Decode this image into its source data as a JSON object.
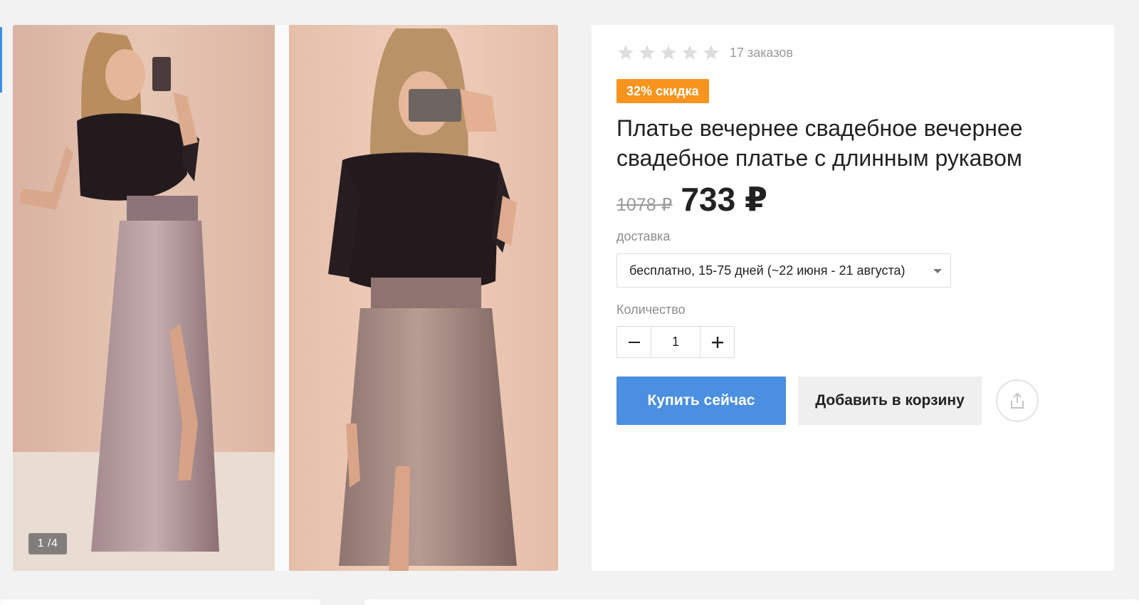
{
  "gallery": {
    "counter": "1 /4",
    "current_image": 1,
    "total_images": 4
  },
  "product": {
    "rating": {
      "stars_filled": 0,
      "stars_total": 5
    },
    "orders": "17 заказов",
    "discount_badge": "32% скидка",
    "title": "Платье вечернее свадебное вечернее свадебное платье с длинным рукавом",
    "old_price": "1078 ₽",
    "new_price": "733 ₽"
  },
  "delivery": {
    "label": "доставка",
    "selected": "бесплатно, 15-75 дней (~22 июня - 21 августа)"
  },
  "quantity": {
    "label": "Количество",
    "value": "1"
  },
  "actions": {
    "buy_label": "Купить сейчас",
    "cart_label": "Добавить в корзину",
    "share_icon": "share-icon"
  },
  "colors": {
    "accent_blue": "#4a8fe0",
    "badge_orange": "#f7941d",
    "star_empty": "#dedede"
  }
}
